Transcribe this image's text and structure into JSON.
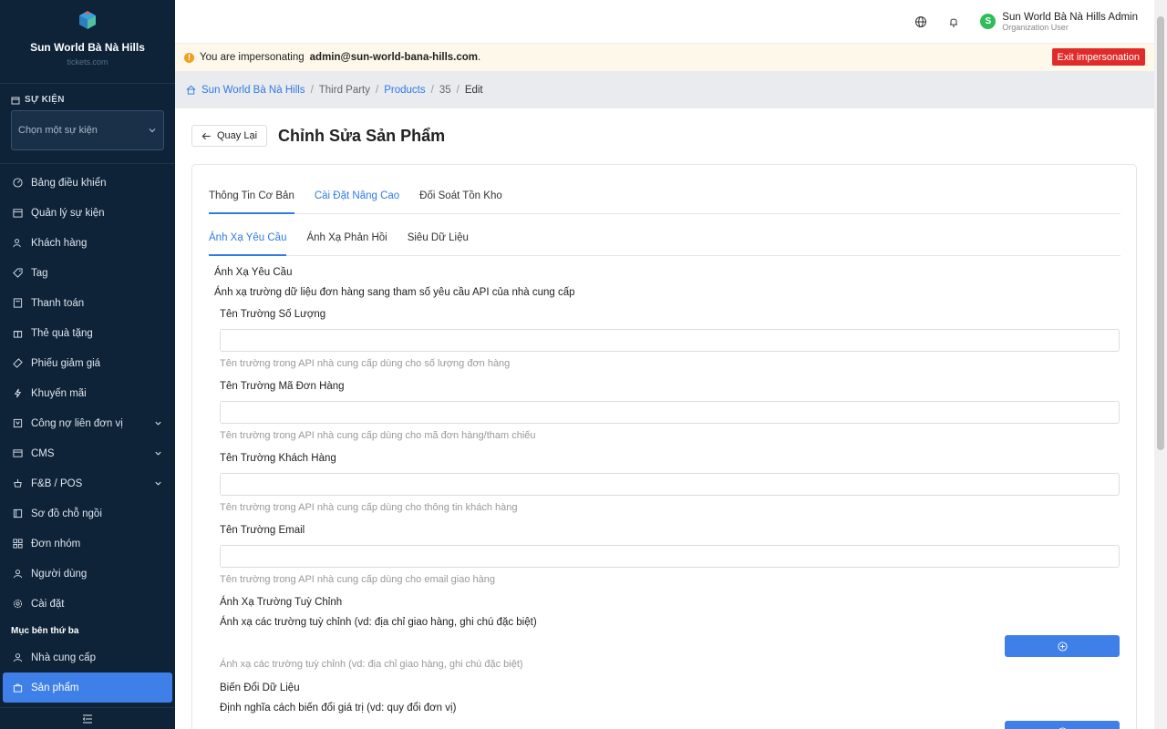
{
  "brand": {
    "name": "Sun World Bà Nà Hills",
    "sub": "tickets.com"
  },
  "sidebar": {
    "event_section_label": "SỰ KIỆN",
    "event_select_placeholder": "Chọn một sự kiện",
    "items": [
      {
        "label": "Bảng điều khiển",
        "icon": "gauge-icon"
      },
      {
        "label": "Quản lý sự kiện",
        "icon": "calendar-icon"
      },
      {
        "label": "Khách hàng",
        "icon": "users-icon"
      },
      {
        "label": "Tag",
        "icon": "tag-icon"
      },
      {
        "label": "Thanh toán",
        "icon": "receipt-icon"
      },
      {
        "label": "Thẻ quà tặng",
        "icon": "gift-icon"
      },
      {
        "label": "Phiếu giảm giá",
        "icon": "ticket-icon"
      },
      {
        "label": "Khuyến mãi",
        "icon": "bolt-icon"
      },
      {
        "label": "Công nợ liên đơn vị",
        "icon": "ledger-icon",
        "expandable": true
      },
      {
        "label": "CMS",
        "icon": "cms-icon",
        "expandable": true
      },
      {
        "label": "F&B / POS",
        "icon": "food-icon",
        "expandable": true
      },
      {
        "label": "Sơ đồ chỗ ngồi",
        "icon": "seat-map-icon"
      },
      {
        "label": "Đơn nhóm",
        "icon": "grid-icon"
      },
      {
        "label": "Người dùng",
        "icon": "user-icon"
      },
      {
        "label": "Cài đặt",
        "icon": "gear-icon"
      }
    ],
    "third_party_label": "Mục bên thứ ba",
    "third_party_items": [
      {
        "label": "Nhà cung cấp",
        "icon": "user-icon"
      },
      {
        "label": "Sản phẩm",
        "icon": "bag-icon",
        "active": true
      }
    ]
  },
  "topbar": {
    "user_initial": "S",
    "user_name": "Sun World Bà Nà Hills Admin",
    "user_role": "Organization User"
  },
  "banner": {
    "prefix": "You are impersonating",
    "email": "admin@sun-world-bana-hills.com",
    "suffix": ".",
    "exit_label": "Exit impersonation"
  },
  "breadcrumb": {
    "home": "Sun World Bà Nà Hills",
    "third_party": "Third Party",
    "products": "Products",
    "id": "35",
    "current": "Edit"
  },
  "page": {
    "back_label": "Quay Lại",
    "title": "Chỉnh Sửa Sản Phẩm"
  },
  "tabs": [
    "Thông Tin Cơ Bản",
    "Cài Đặt Nâng Cao",
    "Đối Soát Tồn Kho"
  ],
  "subtabs": [
    "Ánh Xạ Yêu Cầu",
    "Ánh Xạ Phản Hồi",
    "Siêu Dữ Liệu"
  ],
  "form": {
    "section_title": "Ánh Xạ Yêu Cầu",
    "section_desc": "Ánh xạ trường dữ liệu đơn hàng sang tham số yêu cầu API của nhà cung cấp",
    "fields": [
      {
        "label": "Tên Trường Số Lượng",
        "value": "",
        "help": "Tên trường trong API nhà cung cấp dùng cho số lượng đơn hàng"
      },
      {
        "label": "Tên Trường Mã Đơn Hàng",
        "value": "",
        "help": "Tên trường trong API nhà cung cấp dùng cho mã đơn hàng/tham chiếu"
      },
      {
        "label": "Tên Trường Khách Hàng",
        "value": "",
        "help": "Tên trường trong API nhà cung cấp dùng cho thông tin khách hàng"
      },
      {
        "label": "Tên Trường Email",
        "value": "",
        "help": "Tên trường trong API nhà cung cấp dùng cho email giao hàng"
      }
    ],
    "custom_title": "Ánh Xạ Trường Tuỳ Chỉnh",
    "custom_desc": "Ánh xạ các trường tuỳ chỉnh (vd: địa chỉ giao hàng, ghi chú đặc biệt)",
    "custom_help": "Ánh xạ các trường tuỳ chỉnh (vd: địa chỉ giao hàng, ghi chú đặc biệt)",
    "transform_title": "Biến Đổi Dữ Liệu",
    "transform_desc": "Định nghĩa cách biến đổi giá trị (vd: quy đổi đơn vị)"
  }
}
